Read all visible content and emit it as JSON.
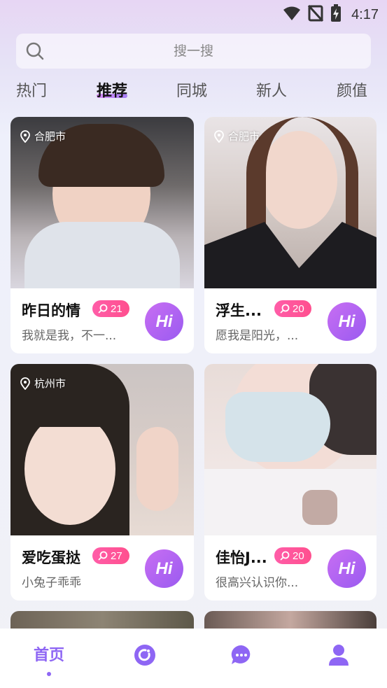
{
  "status_bar": {
    "time": "4:17",
    "icons": [
      "wifi-icon",
      "signal-off-icon",
      "battery-charging-icon"
    ]
  },
  "search": {
    "placeholder": "搜一搜",
    "icon": "search-icon"
  },
  "tabs": [
    {
      "label": "热门",
      "active": false
    },
    {
      "label": "推荐",
      "active": true
    },
    {
      "label": "同城",
      "active": false
    },
    {
      "label": "新人",
      "active": false
    },
    {
      "label": "颜值",
      "active": false
    }
  ],
  "cards": [
    {
      "location": "合肥市",
      "name": "昨日的情",
      "count": "21",
      "bio": "我就是我，不一...",
      "hi_label": "Hi"
    },
    {
      "location": "合肥市",
      "name": "浮生...",
      "count": "20",
      "bio": "愿我是阳光，...",
      "hi_label": "Hi"
    },
    {
      "location": "杭州市",
      "name": "爱吃蛋挞",
      "count": "27",
      "bio": "小兔子乖乖",
      "hi_label": "Hi"
    },
    {
      "location": "",
      "name": "佳怡J...",
      "count": "20",
      "bio": "很高兴认识你...",
      "hi_label": "Hi"
    }
  ],
  "bottom_nav": [
    {
      "label": "首页",
      "icon": "home-label",
      "active": true
    },
    {
      "label": "",
      "icon": "moments-icon",
      "active": false
    },
    {
      "label": "",
      "icon": "chat-bubble-icon",
      "active": false
    },
    {
      "label": "",
      "icon": "profile-icon",
      "active": false
    }
  ],
  "colors": {
    "accent": "#8e66f4",
    "badge": "#ff4f8e",
    "hi_button": "#b065f2"
  }
}
